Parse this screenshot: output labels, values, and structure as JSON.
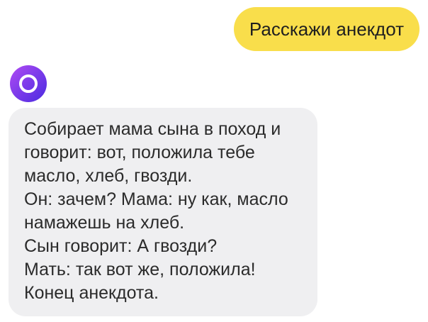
{
  "user_message": {
    "text": "Расскажи анекдот"
  },
  "assistant": {
    "avatar_icon": "alice-logo-icon",
    "message_lines": [
      "Собирает мама сына в поход и",
      "говорит: вот, положила тебе",
      "масло, хлеб, гвозди.",
      "Он: зачем? Мама: ну как, масло",
      "намажешь на хлеб.",
      "Сын говорит: А гвозди?",
      "Мать: так вот же, положила!",
      "Конец анекдота."
    ]
  },
  "colors": {
    "user_bubble": "#f9de4b",
    "bot_bubble": "#efeff1",
    "avatar_gradient_start": "#b14bf3",
    "avatar_gradient_end": "#4b2be0",
    "text": "#2b2b2b"
  }
}
